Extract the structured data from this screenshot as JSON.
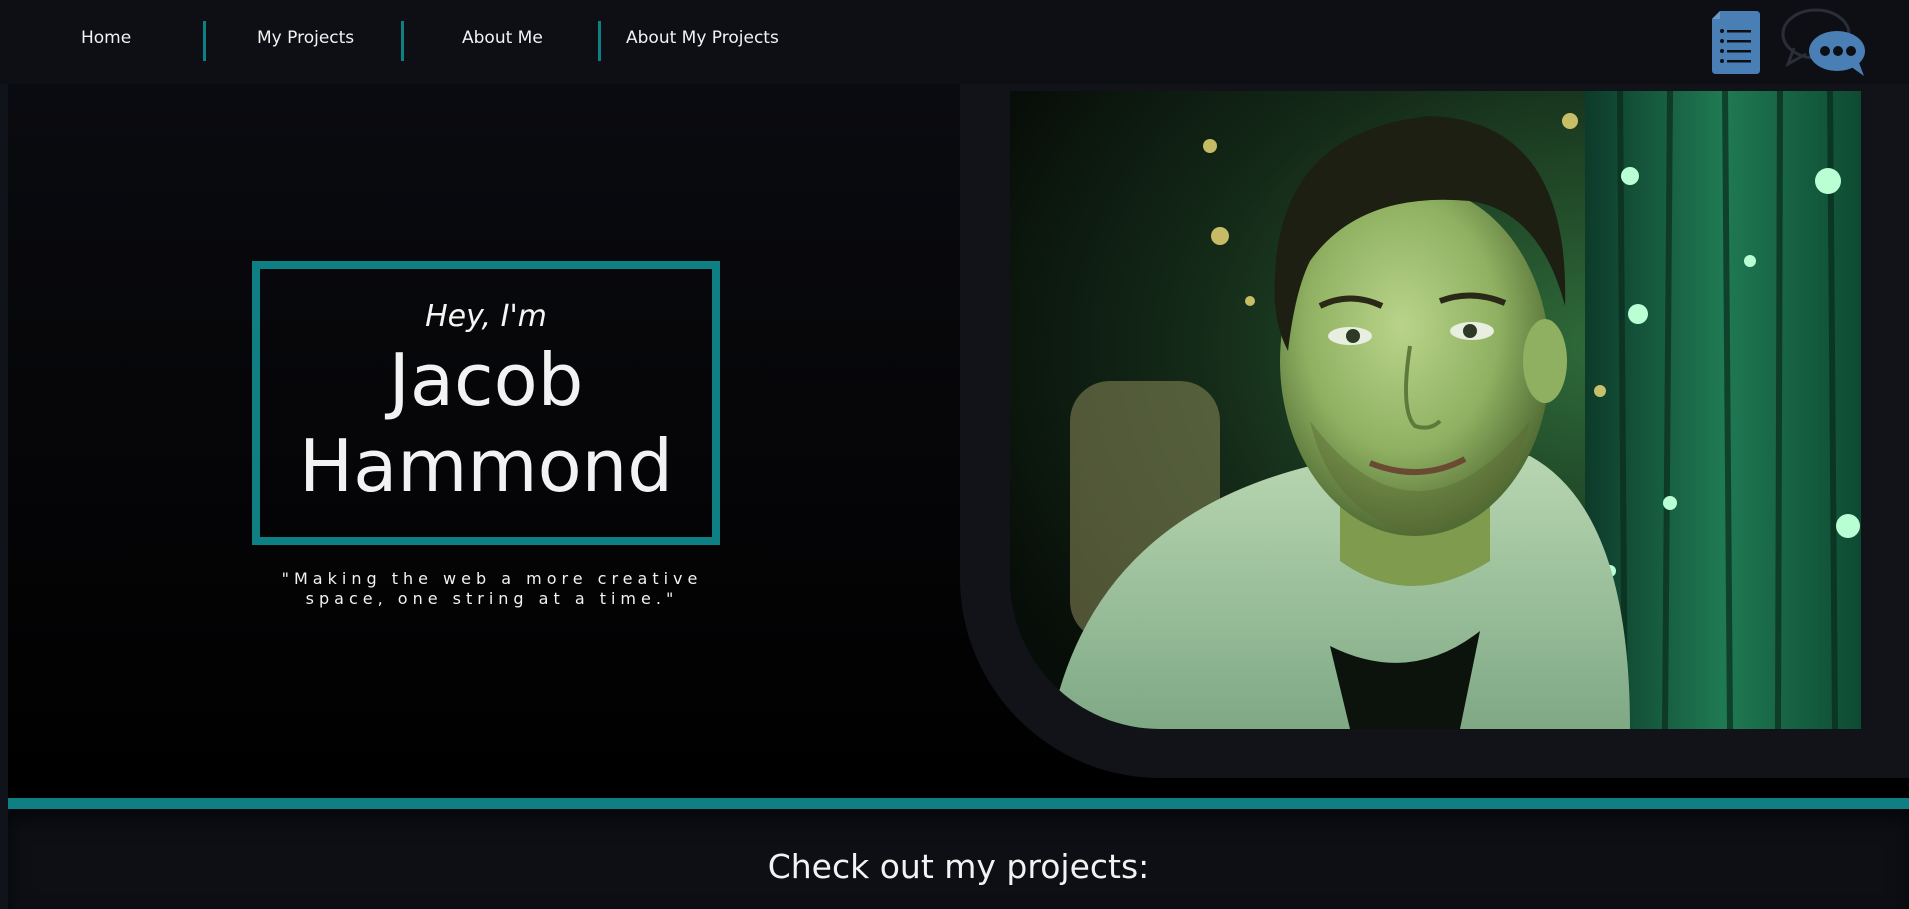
{
  "nav": {
    "items": [
      {
        "label": "Home"
      },
      {
        "label": "My Projects"
      },
      {
        "label": "About Me"
      },
      {
        "label": "About My Projects"
      }
    ],
    "resume_icon": "document-list-icon",
    "chat_icon": "chat-bubbles-icon"
  },
  "hero": {
    "greeting": "Hey, I'm",
    "name_line1": "Jacob",
    "name_line2": "Hammond",
    "tagline": "\"Making the web a more creative space, one string at a time.\"",
    "portrait_icon": "portrait-photo"
  },
  "projects": {
    "heading": "Check out my projects:"
  },
  "colors": {
    "accent": "#0e7f83",
    "background": "#0d0f15",
    "text": "#f2f2f2",
    "icon_blue": "#4a7fb5"
  }
}
